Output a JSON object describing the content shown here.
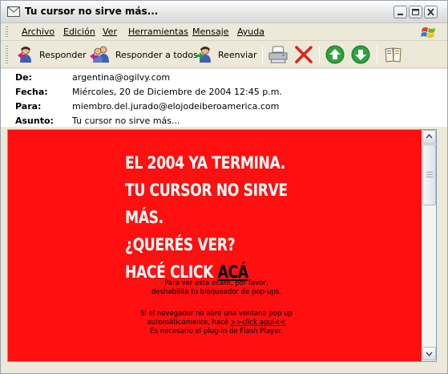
{
  "window": {
    "title": "Tu cursor no sirve más..."
  },
  "menu": {
    "items": [
      "Archivo",
      "Edición",
      "Ver",
      "Herramientas",
      "Mensaje",
      "Ayuda"
    ]
  },
  "toolbar": {
    "reply": "Responder",
    "reply_all": "Responder a todos",
    "forward": "Reenviar",
    "print_icon": "printer-icon",
    "delete_icon": "delete-x-icon",
    "prev_icon": "up-arrow-icon",
    "next_icon": "down-arrow-icon",
    "addresses_icon": "address-book-icon"
  },
  "headers": {
    "from_label": "De:",
    "from_value": "argentina@ogilvy.com",
    "date_label": "Fecha:",
    "date_value": "Miércoles, 20 de Diciembre de 2004 12:45 p.m.",
    "to_label": "Para:",
    "to_value": "miembro.del.jurado@elojodeiberoamerica.com",
    "subject_label": "Asunto:",
    "subject_value": "Tu cursor no sirve más..."
  },
  "message": {
    "background_color": "#ff0f0f",
    "line1": "EL 2004 YA TERMINA.",
    "line2": "TU CURSOR NO SIRVE MÁS.",
    "line3": "¿QUERÉS VER?",
    "line4_prefix": "HACÉ CLICK ",
    "line4_link": "ACÁ",
    "note1": "Para ver esta ecard, por favor,",
    "note2": "deshabilita tu bloqueador de pop-ups.",
    "note3": "Si el navegador no abre una ventana pop up",
    "note4_prefix": "automáticamente, hacé ",
    "note4_link": ">>click aquí<<",
    "note5": "Es necesario el plug-in de Flash Player."
  }
}
